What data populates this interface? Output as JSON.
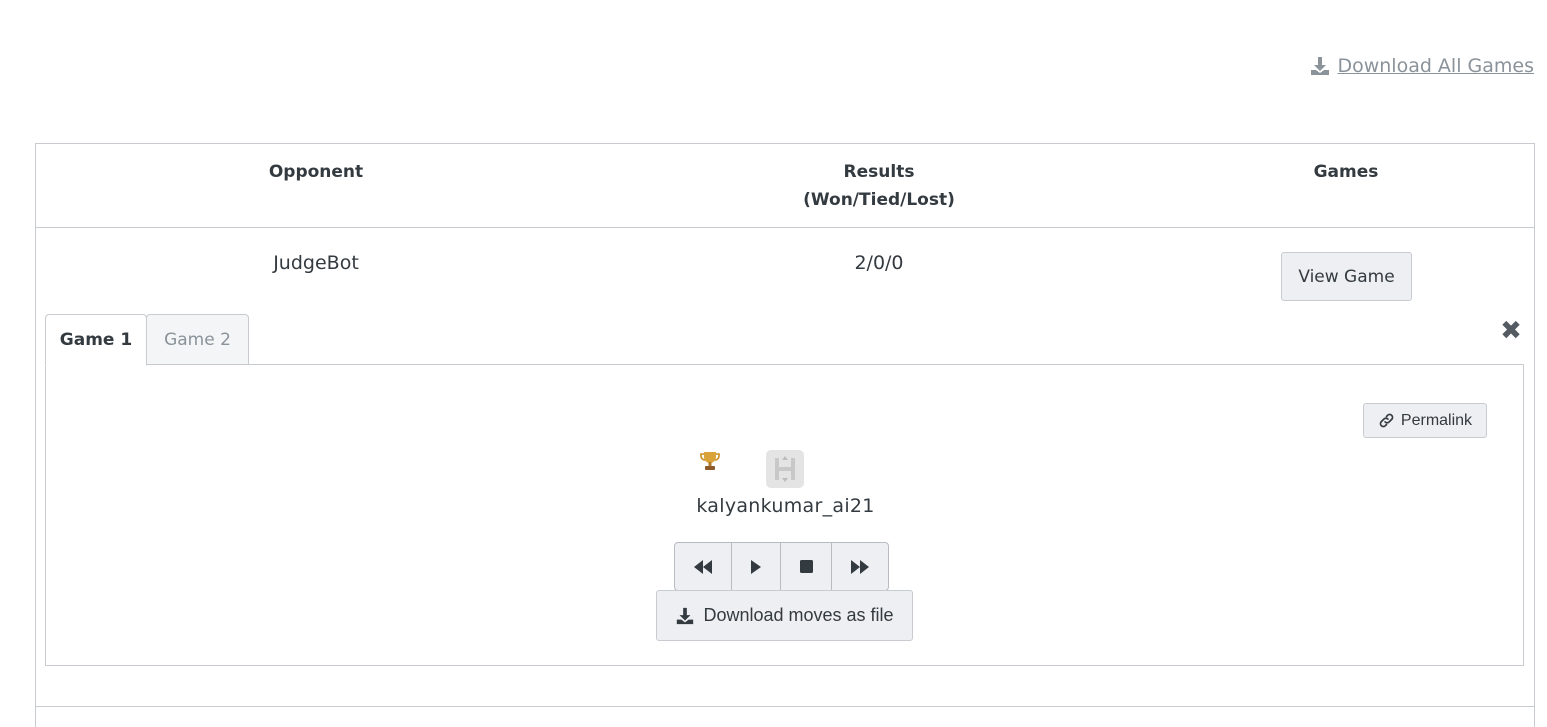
{
  "top": {
    "download_all_label": "Download All Games"
  },
  "table": {
    "headers": {
      "opponent": "Opponent",
      "results_line1": "Results",
      "results_line2": "(Won/Tied/Lost)",
      "games": "Games"
    },
    "row": {
      "opponent": "JudgeBot",
      "results": "2/0/0",
      "view_game_label": "View Game"
    }
  },
  "game_view": {
    "tabs": [
      {
        "label": "Game 1",
        "active": true
      },
      {
        "label": "Game 2",
        "active": false
      }
    ],
    "close_icon": "close-icon",
    "permalink_label": "Permalink",
    "winner_icon": "trophy-icon",
    "player_name": "kalyankumar_ai21",
    "controls": [
      "rewind-icon",
      "play-icon",
      "stop-icon",
      "fast-forward-icon"
    ],
    "download_moves_label": "Download moves as file"
  },
  "colors": {
    "text": "#333a40",
    "muted": "#8a929a",
    "border": "#c8ccd0",
    "button_bg": "#eeeff2"
  }
}
